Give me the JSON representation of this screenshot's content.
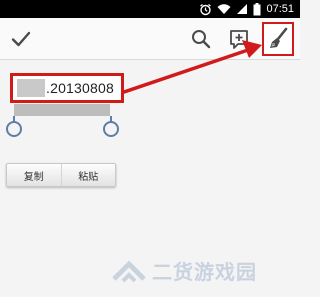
{
  "status_bar": {
    "time": "07:51",
    "icons": [
      "alarm-icon",
      "wifi-icon",
      "cell-signal-icon",
      "battery-icon"
    ]
  },
  "action_bar": {
    "icons": [
      "check-icon",
      "search-icon",
      "new-tab-icon",
      "brush-icon"
    ]
  },
  "url_field": {
    "value": ".20130808"
  },
  "clipboard_menu": {
    "copy_label": "复制",
    "paste_label": "粘贴"
  },
  "watermark": {
    "text": "二货游戏园"
  },
  "colors": {
    "highlight_red": "#d11a1a",
    "handle_blue": "#5d7ea6",
    "selection_gray": "#bdbdbd"
  }
}
